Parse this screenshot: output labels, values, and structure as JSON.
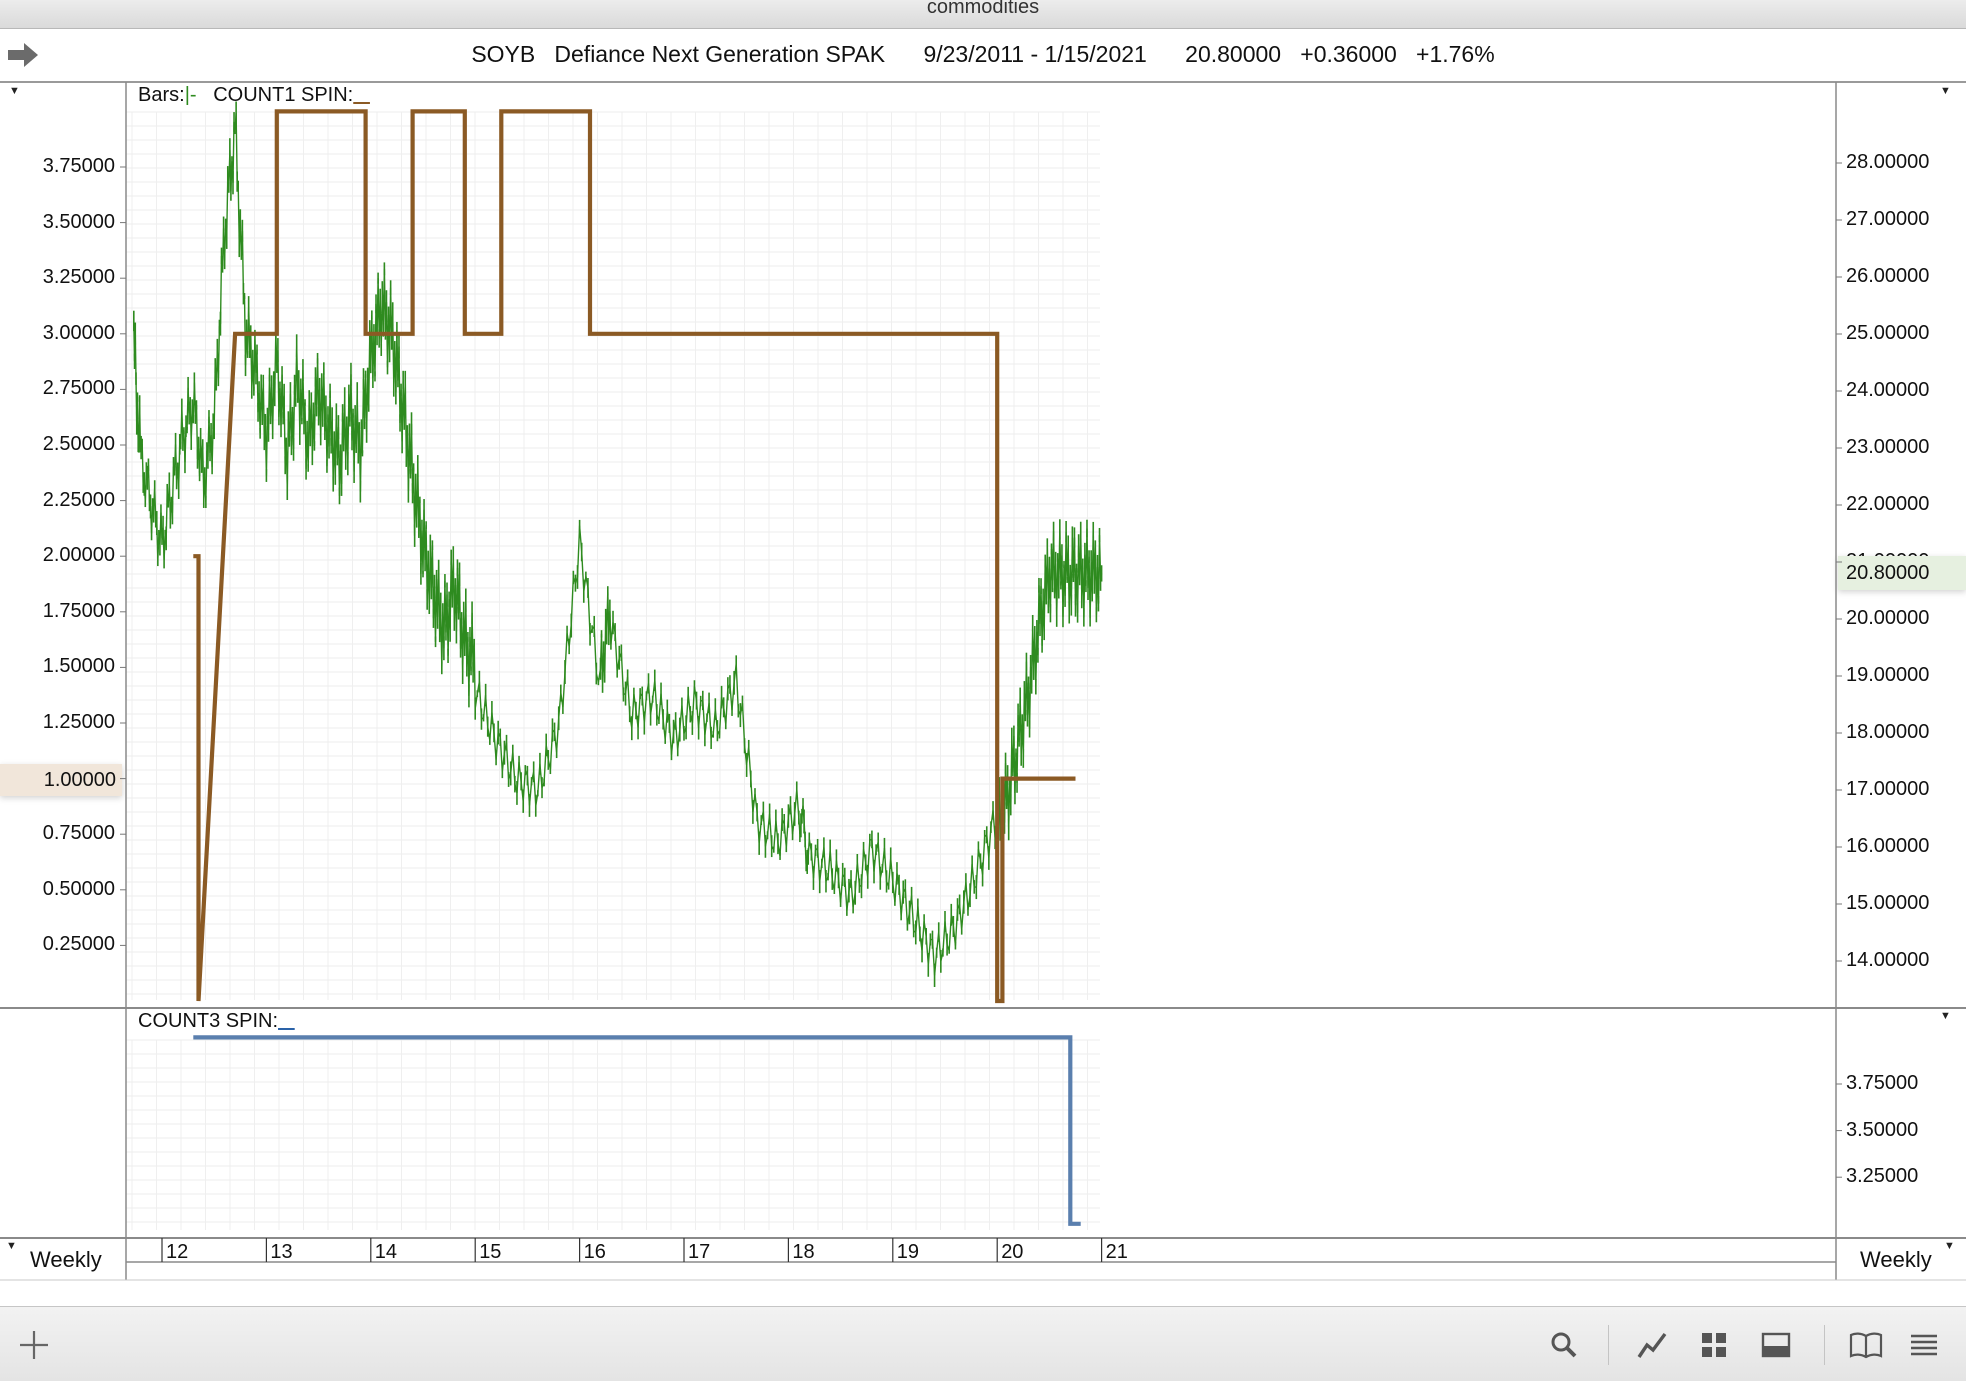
{
  "window": {
    "title": "commodities"
  },
  "info": {
    "symbol": "SOYB",
    "name": "Defiance Next Generation SPAK",
    "date_range": "9/23/2011 - 1/15/2021",
    "last": "20.80000",
    "change": "+0.36000",
    "change_pct": "+1.76%"
  },
  "main_panel": {
    "legend_bars": "Bars:",
    "legend_bars_marker": "|-",
    "legend_count1": "COUNT1 SPIN:",
    "left_axis_labels": [
      "3.75000",
      "3.50000",
      "3.25000",
      "3.00000",
      "2.75000",
      "2.50000",
      "2.25000",
      "2.00000",
      "1.75000",
      "1.50000",
      "1.25000",
      "1.00000",
      "0.75000",
      "0.50000",
      "0.25000"
    ],
    "left_highlight": "1.00000",
    "right_axis_labels": [
      "28.00000",
      "27.00000",
      "26.00000",
      "25.00000",
      "24.00000",
      "23.00000",
      "22.00000",
      "21.00000",
      "20.00000",
      "19.00000",
      "18.00000",
      "17.00000",
      "16.00000",
      "15.00000",
      "14.00000"
    ],
    "right_highlight": "20.80000"
  },
  "lower_panel": {
    "legend_count3": "COUNT3 SPIN:",
    "right_axis_labels": [
      "3.75000",
      "3.50000",
      "3.25000"
    ]
  },
  "time_axis": {
    "labels": [
      "12",
      "13",
      "14",
      "15",
      "16",
      "17",
      "18",
      "19",
      "20",
      "21"
    ],
    "left_period": "Weekly",
    "right_period": "Weekly"
  },
  "colors": {
    "price": "#2e8b1f",
    "count1": "#8b5a24",
    "count3": "#5a7fae"
  },
  "chart_data": [
    {
      "type": "line",
      "title": "",
      "series": [
        {
          "name": "Bars",
          "axis": "right",
          "x": [
            2011.73,
            2011.8,
            2011.9,
            2012.0,
            2012.1,
            2012.2,
            2012.3,
            2012.4,
            2012.5,
            2012.6,
            2012.7,
            2012.8,
            2012.9,
            2013.0,
            2013.1,
            2013.2,
            2013.3,
            2013.4,
            2013.5,
            2013.6,
            2013.7,
            2013.8,
            2013.9,
            2014.0,
            2014.1,
            2014.2,
            2014.3,
            2014.4,
            2014.5,
            2014.6,
            2014.7,
            2014.8,
            2014.9,
            2015.0,
            2015.2,
            2015.4,
            2015.6,
            2015.8,
            2016.0,
            2016.2,
            2016.3,
            2016.5,
            2016.7,
            2016.9,
            2017.1,
            2017.3,
            2017.5,
            2017.7,
            2017.9,
            2018.1,
            2018.2,
            2018.4,
            2018.6,
            2018.8,
            2019.0,
            2019.2,
            2019.4,
            2019.6,
            2019.8,
            2020.0,
            2020.1,
            2020.2,
            2020.3,
            2020.4,
            2020.5,
            2020.6,
            2020.7,
            2020.8,
            2020.9,
            2021.0
          ],
          "values": [
            24.8,
            22.8,
            22.0,
            21.3,
            22.3,
            23.2,
            23.8,
            22.4,
            23.5,
            26.8,
            28.6,
            25.1,
            24.3,
            23.2,
            24.5,
            22.9,
            24.2,
            23.1,
            24.0,
            23.3,
            22.8,
            23.6,
            23.0,
            24.6,
            25.5,
            25.0,
            23.8,
            22.5,
            21.3,
            20.5,
            19.8,
            20.6,
            19.6,
            19.2,
            18.3,
            17.6,
            17.4,
            18.5,
            21.7,
            19.1,
            20.2,
            18.6,
            18.9,
            18.1,
            18.7,
            18.2,
            19.0,
            16.5,
            16.1,
            16.7,
            15.8,
            15.5,
            15.0,
            15.8,
            15.2,
            14.5,
            13.8,
            14.3,
            15.2,
            16.2,
            16.9,
            17.8,
            18.7,
            19.9,
            20.8,
            20.8,
            20.8,
            20.8,
            20.8,
            20.8
          ]
        },
        {
          "name": "COUNT1 SPIN",
          "axis": "left",
          "x": [
            2012.3,
            2012.35,
            2012.35,
            2012.7,
            2012.7,
            2013.1,
            2013.1,
            2013.95,
            2013.95,
            2014.4,
            2014.4,
            2014.9,
            2014.9,
            2015.25,
            2015.25,
            2016.1,
            2016.1,
            2016.6,
            2016.6,
            2020.0,
            2020.0,
            2020.05,
            2020.05,
            2020.75
          ],
          "values": [
            2.0,
            2.0,
            0.0,
            3.0,
            3.0,
            3.0,
            4.0,
            4.0,
            3.0,
            3.0,
            4.0,
            4.0,
            3.0,
            3.0,
            4.0,
            4.0,
            3.0,
            3.0,
            3.0,
            3.0,
            0.0,
            0.0,
            1.0,
            1.0
          ]
        },
        {
          "name": "COUNT3 SPIN",
          "axis": "lower",
          "x": [
            2012.3,
            2020.7,
            2020.7,
            2020.8
          ],
          "values": [
            4.0,
            4.0,
            3.0,
            3.0
          ]
        }
      ],
      "xlabel": "",
      "ylabel": "",
      "ylim_left": [
        0,
        4
      ],
      "ylim_right": [
        13.2,
        29.0
      ],
      "ylim_lower": [
        3.0,
        4.0
      ],
      "grid": true,
      "period": "Weekly"
    }
  ]
}
